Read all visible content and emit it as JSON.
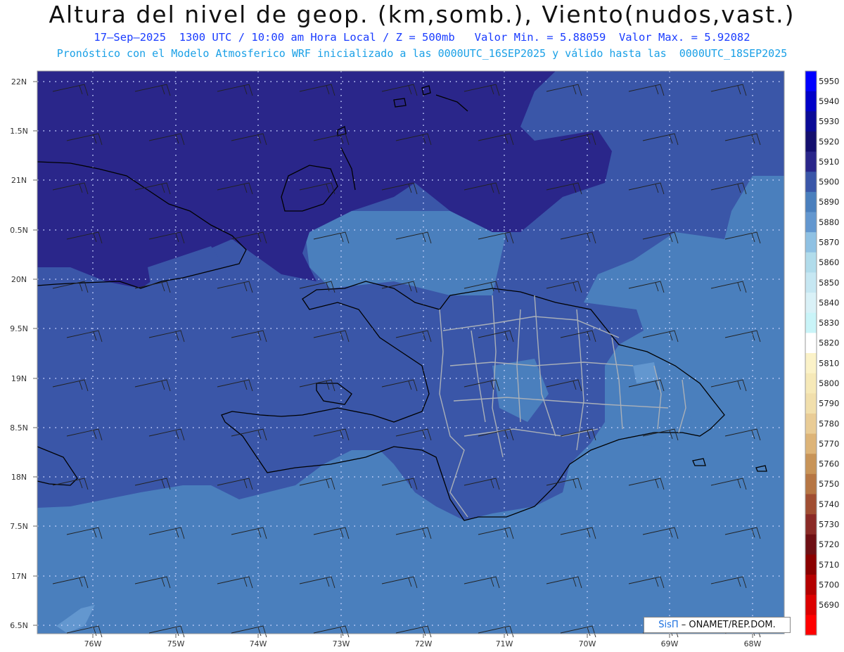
{
  "header": {
    "title": "Altura del nivel de geop. (km,somb.), Viento(nudos,vast.)",
    "line1": "17–Sep–2025  1300 UTC / 10:00 am Hora Local / Z = 500mb   Valor Min. = 5.88059  Valor Max. = 5.92082",
    "line2": "Pronóstico con el Modelo Atmosferico WRF inicializado a las 0000UTC_16SEP2025 y válido hasta las  0000UTC_18SEP2025"
  },
  "axes": {
    "lat_labels": [
      "22N",
      "1.5N",
      "21N",
      "0.5N",
      "20N",
      "9.5N",
      "19N",
      "8.5N",
      "18N",
      "7.5N",
      "17N",
      "6.5N"
    ],
    "lon_labels": [
      "76W",
      "75W",
      "74W",
      "73W",
      "72W",
      "71W",
      "70W",
      "69W",
      "68W"
    ]
  },
  "colorbar": {
    "levels": [
      {
        "label": "5950",
        "color": "#0000ff"
      },
      {
        "label": "5940",
        "color": "#0000c8"
      },
      {
        "label": "5930",
        "color": "#0a0a96"
      },
      {
        "label": "5920",
        "color": "#140f6e"
      },
      {
        "label": "5910",
        "color": "#2a268a"
      },
      {
        "label": "5900",
        "color": "#3a56a8"
      },
      {
        "label": "5890",
        "color": "#4a7fbd"
      },
      {
        "label": "5880",
        "color": "#6397cf"
      },
      {
        "label": "5870",
        "color": "#8fc1e3"
      },
      {
        "label": "5860",
        "color": "#b1dceb"
      },
      {
        "label": "5850",
        "color": "#c6e7f2"
      },
      {
        "label": "5840",
        "color": "#d9f1f7"
      },
      {
        "label": "5830",
        "color": "#c9f4f8"
      },
      {
        "label": "5820",
        "color": "#ffffff"
      },
      {
        "label": "5810",
        "color": "#fbf2c8"
      },
      {
        "label": "5800",
        "color": "#f6e9b8"
      },
      {
        "label": "5790",
        "color": "#f1dfac"
      },
      {
        "label": "5780",
        "color": "#e9cc96"
      },
      {
        "label": "5770",
        "color": "#ddb478"
      },
      {
        "label": "5760",
        "color": "#c89458"
      },
      {
        "label": "5750",
        "color": "#b67644"
      },
      {
        "label": "5740",
        "color": "#a04e32"
      },
      {
        "label": "5730",
        "color": "#8a2a26"
      },
      {
        "label": "5720",
        "color": "#6e0f14"
      },
      {
        "label": "5710",
        "color": "#8a0000"
      },
      {
        "label": "5700",
        "color": "#b40000"
      },
      {
        "label": "5690",
        "color": "#dc0000"
      },
      {
        "label": "",
        "color": "#ff0000"
      }
    ]
  },
  "credit": {
    "brand": "SisΠ",
    "text": "– ONAMET/REP.DOM."
  }
}
